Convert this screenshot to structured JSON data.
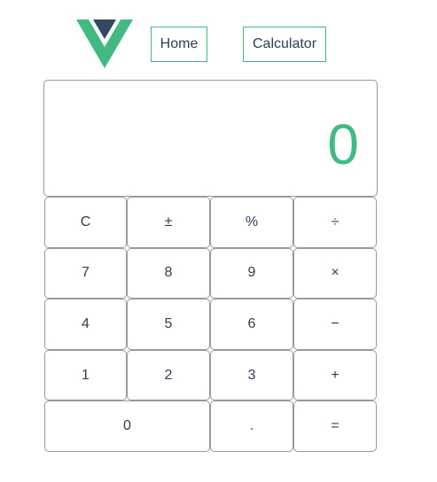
{
  "colors": {
    "accent": "#42b983",
    "dark": "#35495e",
    "text": "#2c3e50",
    "border": "#999999"
  },
  "logo": {
    "icon": "vue-logo-icon"
  },
  "nav": {
    "home_label": "Home",
    "calculator_label": "Calculator"
  },
  "display": {
    "value": "0"
  },
  "keys": {
    "clear": "C",
    "sign": "±",
    "percent": "%",
    "divide": "÷",
    "seven": "7",
    "eight": "8",
    "nine": "9",
    "multiply": "×",
    "four": "4",
    "five": "5",
    "six": "6",
    "minus": "−",
    "one": "1",
    "two": "2",
    "three": "3",
    "plus": "+",
    "zero": "0",
    "dot": ".",
    "equals": "="
  }
}
